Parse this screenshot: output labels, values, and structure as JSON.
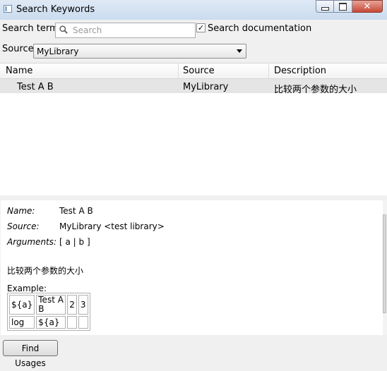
{
  "window": {
    "title": "Search Keywords",
    "minimize_icon": "minimize-icon",
    "maximize_icon": "maximize-icon",
    "close_icon": "close-icon"
  },
  "search": {
    "label": "Search term:",
    "placeholder": "Search",
    "value": "",
    "doc_checkbox_label": "Search documentation",
    "doc_checkbox_checked": true,
    "doc_checkbox_mark": "✓"
  },
  "source": {
    "label": "Source:",
    "selected": "MyLibrary"
  },
  "table": {
    "headers": [
      "Name",
      "Source",
      "Description"
    ],
    "rows": [
      {
        "name": "Test A B",
        "source": "MyLibrary",
        "description": "比较两个参数的大小"
      }
    ]
  },
  "details": {
    "name_key": "Name:",
    "name_value": "Test A B",
    "source_key": "Source:",
    "source_value": "MyLibrary <test library>",
    "arguments_key": "Arguments:",
    "arguments_value": "[ a | b ]",
    "doc": "比较两个参数的大小",
    "example_label": "Example:",
    "example_table": [
      [
        "${a}",
        "Test A B",
        "2",
        "3"
      ],
      [
        "log",
        "${a}",
        "",
        ""
      ]
    ]
  },
  "buttons": {
    "find_usages": "Find Usages"
  }
}
